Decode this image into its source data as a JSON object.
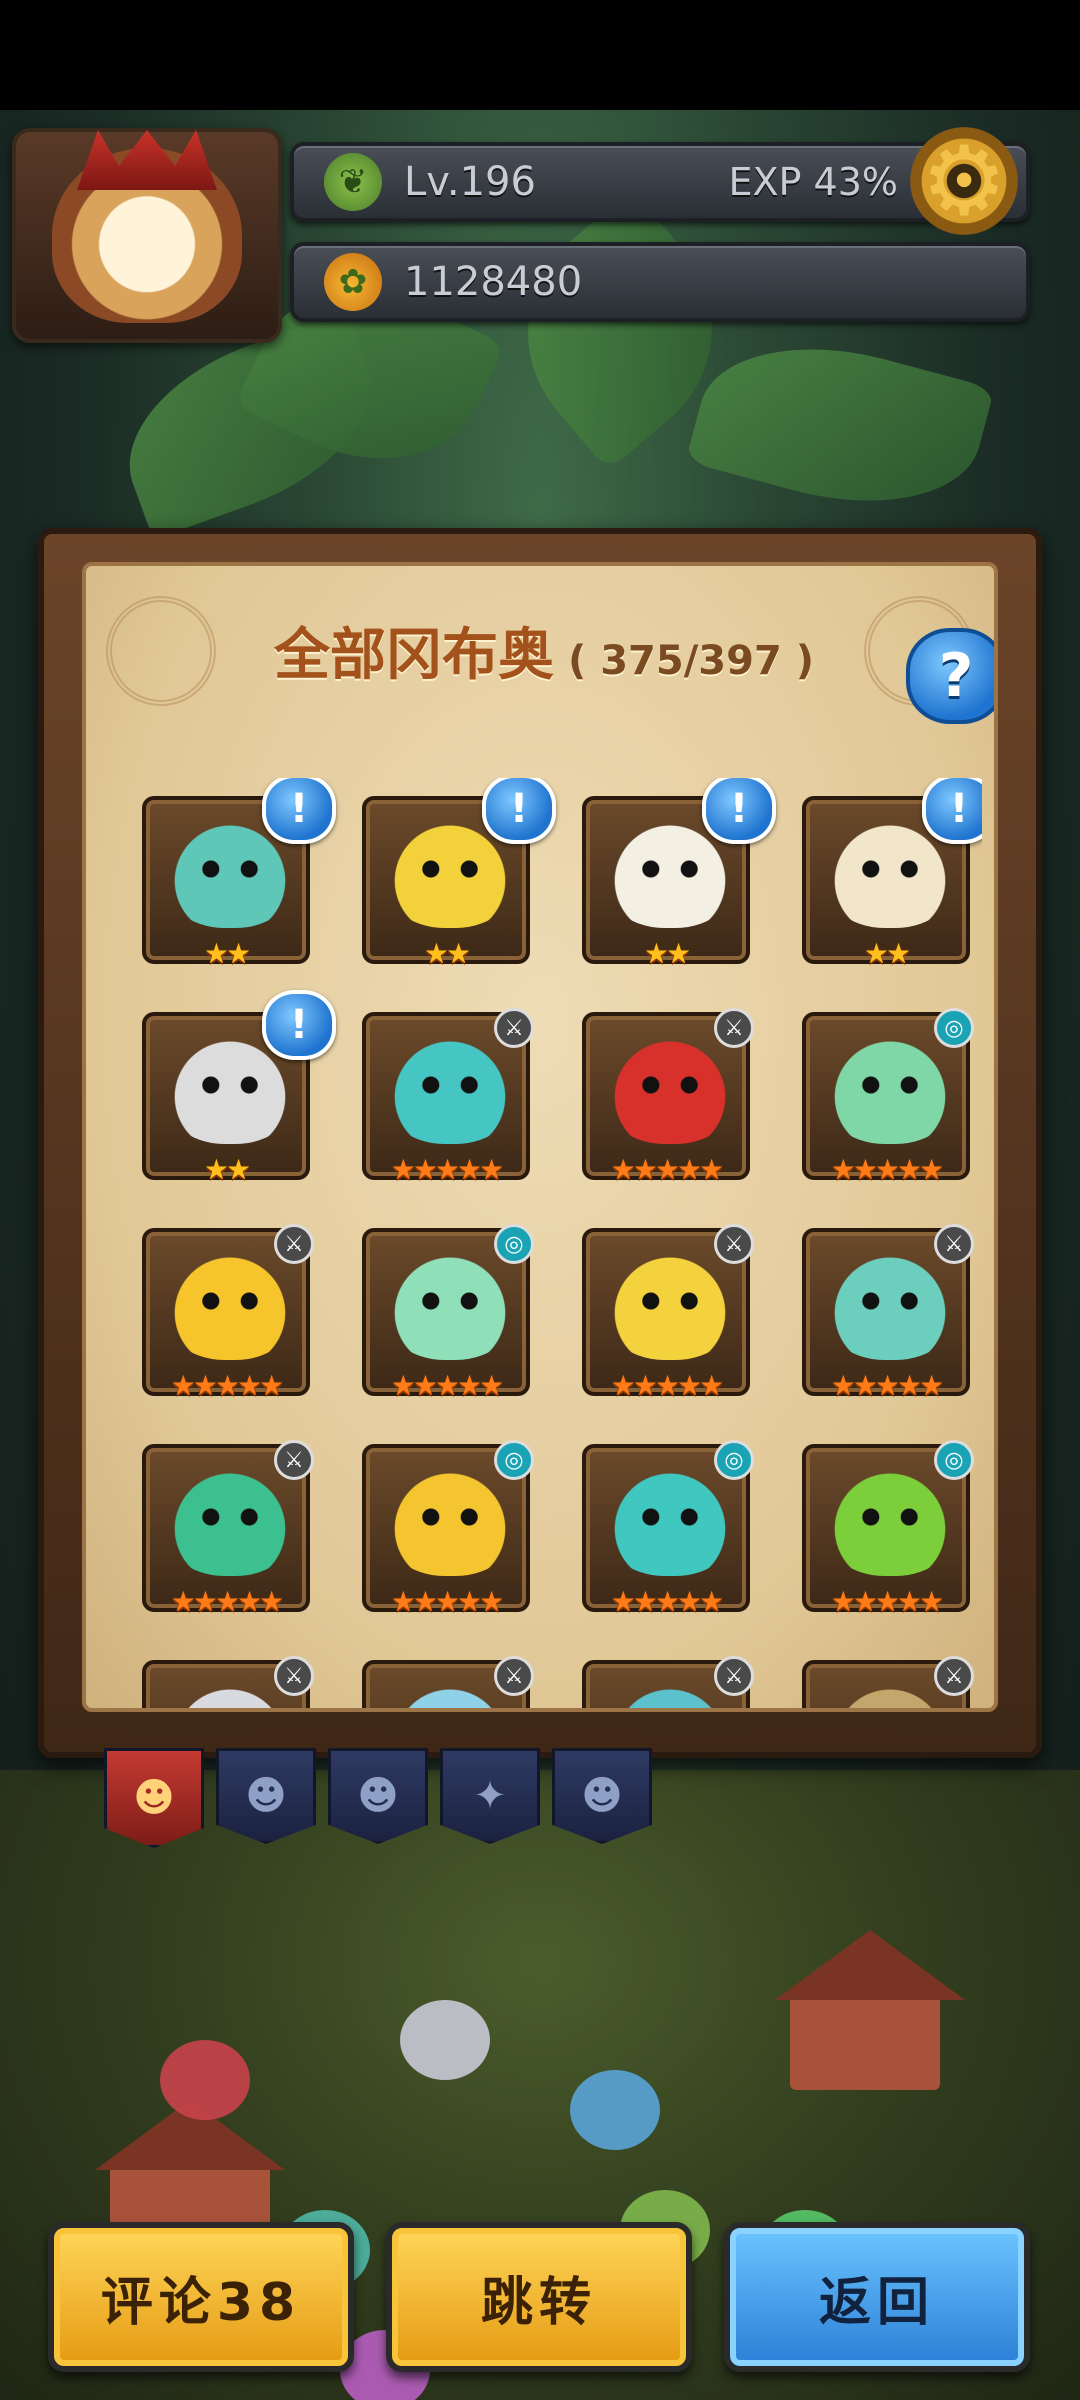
{
  "hud": {
    "level_label": "Lv.196",
    "exp_label": "EXP 43%",
    "coins": "1128480",
    "level_icon": "leaf-icon",
    "coin_icon": "fruit-icon",
    "settings_icon": "gear-icon"
  },
  "panel": {
    "title": "全部冈布奥",
    "count": "( 375/397 )",
    "help_label": "?"
  },
  "cards": [
    {
      "stars": "★★",
      "badge": "!",
      "color": "#5fc7b8"
    },
    {
      "stars": "★★",
      "badge": "!",
      "color": "#f2d13a"
    },
    {
      "stars": "★★",
      "badge": "!",
      "color": "#f4efe3"
    },
    {
      "stars": "★★",
      "badge": "!",
      "color": "#f1e6c9"
    },
    {
      "stars": "★★",
      "badge": "!",
      "color": "#dcdcdc"
    },
    {
      "stars": "★★★★★",
      "mini": "sword",
      "color": "#45c6c2"
    },
    {
      "stars": "★★★★★",
      "mini": "sword",
      "color": "#d8312c"
    },
    {
      "stars": "★★★★★",
      "mini": "swirl",
      "color": "#7fd6a7"
    },
    {
      "stars": "★★★★★",
      "mini": "sword",
      "color": "#f6c52c"
    },
    {
      "stars": "★★★★★",
      "mini": "swirl",
      "color": "#8fe0b9"
    },
    {
      "stars": "★★★★★",
      "mini": "sword",
      "color": "#f4d23e"
    },
    {
      "stars": "★★★★★",
      "mini": "sword",
      "color": "#6ccfbe"
    },
    {
      "stars": "★★★★★",
      "mini": "sword",
      "color": "#3cc08f"
    },
    {
      "stars": "★★★★★",
      "mini": "swirl",
      "color": "#f4c52e"
    },
    {
      "stars": "★★★★★",
      "mini": "swirl",
      "color": "#40c8c0"
    },
    {
      "stars": "★★★★★",
      "mini": "swirl",
      "color": "#7ccf3a"
    },
    {
      "stars": "",
      "mini": "sword",
      "color": "#d9d9e0"
    },
    {
      "stars": "",
      "mini": "sword",
      "color": "#8fd1e6"
    },
    {
      "stars": "",
      "mini": "sword",
      "color": "#5bc1cc"
    },
    {
      "stars": "",
      "mini": "sword",
      "color": "#c2a66b"
    }
  ],
  "bottom": {
    "comment_label": "评论38",
    "jump_label": "跳转",
    "back_label": "返回"
  },
  "colors": {
    "accent_gold": "#e59a12",
    "accent_blue": "#2b7fd6",
    "title_orange": "#a3521b"
  }
}
